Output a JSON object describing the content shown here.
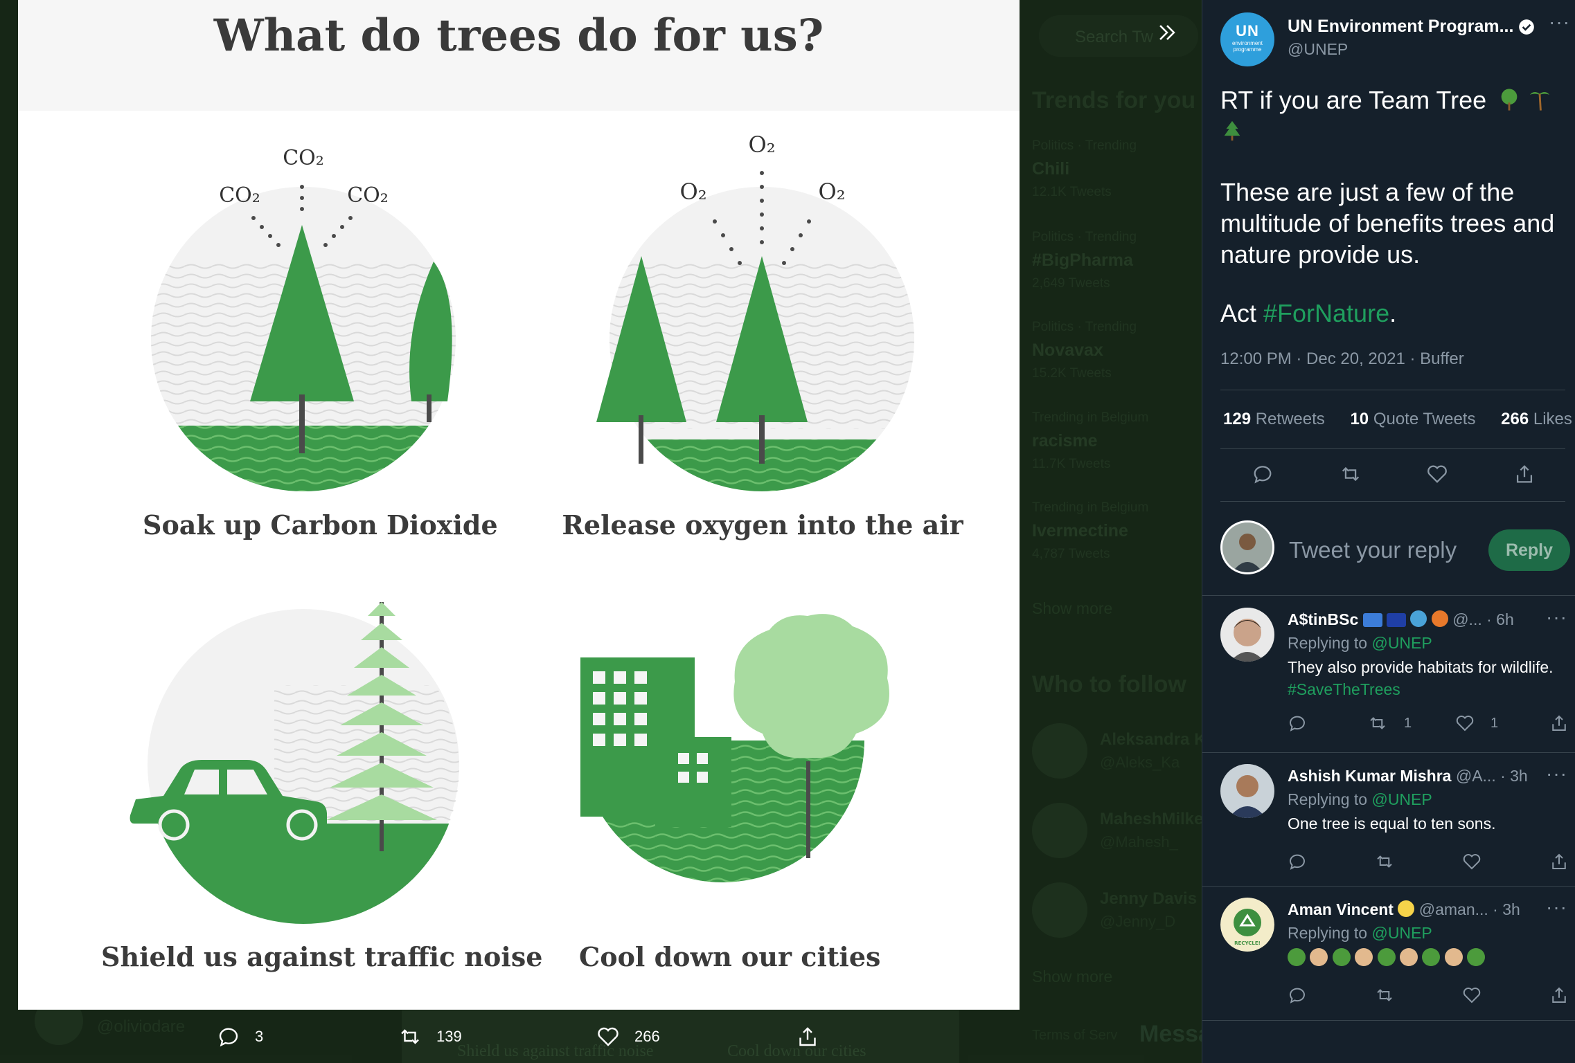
{
  "background": {
    "search_placeholder": "Search Tw",
    "trends_title": "Trends for you",
    "trends": [
      {
        "meta": "Politics · Trending",
        "name": "Chili",
        "count": "12.1K Tweets"
      },
      {
        "meta": "Politics · Trending",
        "name": "#BigPharma",
        "count": "2,649 Tweets"
      },
      {
        "meta": "Politics · Trending",
        "name": "Novavax",
        "count": "15.2K Tweets"
      },
      {
        "meta": "Trending in Belgium",
        "name": "racisme",
        "count": "11.7K Tweets"
      },
      {
        "meta": "Trending in Belgium",
        "name": "Ivermectine",
        "count": "4,787 Tweets"
      }
    ],
    "show_more": "Show more",
    "who_to_follow": "Who to follow",
    "people": [
      {
        "name": "Aleksandra K",
        "handle": "@Aleks_Ka"
      },
      {
        "name": "MaheshMilke",
        "handle": "@Mahesh_"
      },
      {
        "name": "Jenny Davis",
        "handle": "@Jenny_D"
      }
    ],
    "terms": "Terms of Serv",
    "messages": "Messa",
    "user_handle": "@oliviodare",
    "bottom_captions": [
      "Shield us against traffic noise",
      "Cool down our cities"
    ]
  },
  "media": {
    "title": "What do trees do for us?",
    "captions": [
      "Soak up Carbon Dioxide",
      "Release oxygen into the air",
      "Shield us against traffic noise",
      "Cool down our cities"
    ],
    "co2_label": "CO₂",
    "o2_label": "O₂",
    "colors": {
      "dark_green": "#3c9a4a",
      "light_green": "#a8dba0",
      "mid_green": "#6cbf6e"
    }
  },
  "media_actions": {
    "replies": "3",
    "retweets": "139",
    "likes": "266"
  },
  "tweet": {
    "author_name": "UN Environment Program...",
    "author_handle": "@UNEP",
    "avatar_text": "UN",
    "avatar_sub": "environment programme",
    "line1": "RT if you are Team Tree",
    "para2": "These are just a few of the multitude of benefits trees and nature provide us.",
    "act_prefix": "Act ",
    "hashtag": "#ForNature",
    "act_suffix": ".",
    "timestamp": "12:00 PM · Dec 20, 2021 · Buffer",
    "retweets_count": "129",
    "retweets_label": "Retweets",
    "quotes_count": "10",
    "quotes_label": "Quote Tweets",
    "likes_count": "266",
    "likes_label": "Likes"
  },
  "reply_box": {
    "placeholder": "Tweet your reply",
    "button": "Reply"
  },
  "replies": [
    {
      "name": "A$tinBSc",
      "meta": "@... · 6h",
      "replying_prefix": "Replying to ",
      "replying_to": "@UNEP",
      "text": "They also provide habitats for wildlife.",
      "hashtag": "#SaveTheTrees",
      "retweets": "1",
      "likes": "1"
    },
    {
      "name": "Ashish Kumar Mishra",
      "meta": "@A... · 3h",
      "replying_prefix": "Replying to ",
      "replying_to": "@UNEP",
      "text": "One tree is equal to ten sons.",
      "retweets": "",
      "likes": ""
    },
    {
      "name": "Aman Vincent",
      "meta": "@aman... · 3h",
      "replying_prefix": "Replying to ",
      "replying_to": "@UNEP",
      "text": "",
      "retweets": "",
      "likes": "",
      "avatar_text": "RECYCLE!"
    }
  ]
}
